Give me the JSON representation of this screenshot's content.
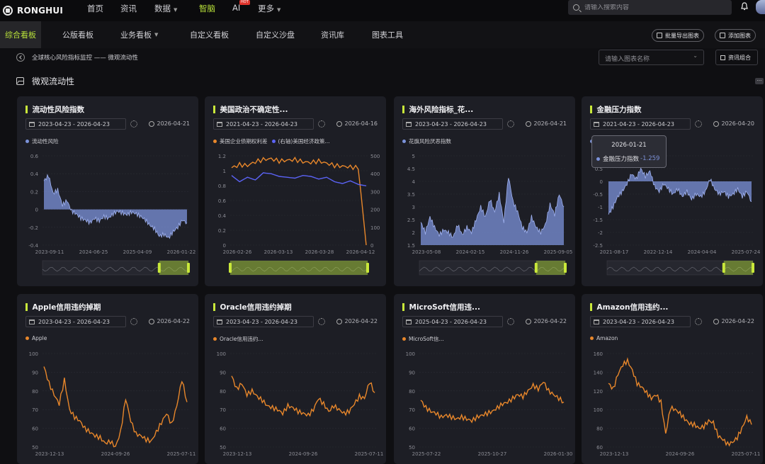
{
  "brand": {
    "name": "RONGHUI"
  },
  "topnav": {
    "items": [
      "首页",
      "资讯",
      "数据",
      "智脑",
      "AI",
      "更多"
    ],
    "ai_badge": "HOT",
    "search_placeholder": "请输入搜索内容"
  },
  "subnav": {
    "tabs": [
      "综合看板",
      "公版看板",
      "业务看板",
      "自定义看板",
      "自定义沙盘",
      "资讯库",
      "图表工具"
    ],
    "export_label": "批量导出图表",
    "add_label": "添加图表",
    "chart_name_placeholder": "请输入图表名称",
    "combo_label": "资讯组合"
  },
  "breadcrumb": "全球核心风险指标监控 —— 微观流动性",
  "section_title": "微观流动性",
  "tooltip": {
    "date": "2026-01-21",
    "series": "金融压力指数",
    "value": "-1.259"
  },
  "colors": {
    "accent": "#c9e83a",
    "blue": "#7c93db",
    "orange": "#e8872b",
    "blue2": "#5b63f5"
  },
  "cards": [
    {
      "title": "流动性风险指数",
      "range": "2023-04-23  -  2026-04-23",
      "updated": "2026-04-21",
      "legend": "流动性风险",
      "legend_color": "#7c93db"
    },
    {
      "title": "美国政治不确定性...",
      "range": "2021-04-23  -  2026-04-23",
      "updated": "2026-04-16",
      "legend": "美国企业债期权利差",
      "legend_color": "#e8872b",
      "legend2": "(右轴)美国经济政策...",
      "legend2_color": "#5b63f5"
    },
    {
      "title": "海外风险指标_花...",
      "range": "2023-04-23  -  2026-04-23",
      "updated": "2026-04-21",
      "legend": "花旗风险厌恶指数",
      "legend_color": "#7c93db"
    },
    {
      "title": "金融压力指数",
      "range": "2021-04-23  -  2026-04-23",
      "updated": "2026-04-20",
      "legend": "金融压力指数",
      "legend_color": "#7c93db"
    },
    {
      "title": "Apple信用违约掉期",
      "range": "2023-04-23  -  2026-04-23",
      "updated": "2026-04-22",
      "legend": "Apple",
      "legend_color": "#e8872b"
    },
    {
      "title": "Oracle信用违约掉期",
      "range": "2023-04-23  -  2026-04-23",
      "updated": "2026-04-22",
      "legend": "Oracle信用违约...",
      "legend_color": "#e8872b"
    },
    {
      "title": "MicroSoft信用违...",
      "range": "2025-04-23  -  2026-04-23",
      "updated": "2026-04-22",
      "legend": "MicroSoft信...",
      "legend_color": "#e8872b"
    },
    {
      "title": "Amazon信用违约...",
      "range": "2023-04-23  -  2026-04-23",
      "updated": "2026-04-22",
      "legend": "Amazon",
      "legend_color": "#e8872b"
    }
  ],
  "chart_data": [
    {
      "type": "area",
      "ylabels": [
        "0.6",
        "0.4",
        "0.2",
        "0",
        "-0.2",
        "-0.4"
      ],
      "xlabels": [
        "2023-09-11",
        "2024-06-25",
        "2025-04-09",
        "2026-01-22"
      ],
      "series": [
        {
          "name": "流动性风险",
          "values": [
            0.32,
            0.38,
            0.18,
            0.22,
            0.05,
            0.1,
            -0.02,
            -0.05,
            -0.1,
            -0.12,
            -0.15,
            -0.1,
            -0.13,
            -0.08,
            -0.1,
            -0.05,
            -0.02,
            -0.04,
            -0.06,
            -0.03,
            -0.05,
            -0.08,
            -0.12,
            -0.18,
            -0.22,
            -0.3,
            -0.28,
            -0.32,
            -0.25,
            -0.2,
            -0.12,
            -0.15
          ]
        }
      ]
    },
    {
      "type": "line",
      "ylabels": [
        "1.2",
        "1",
        "0.8",
        "0.6",
        "0.4",
        "0.2",
        "0"
      ],
      "y2labels": [
        "500",
        "400",
        "300",
        "200",
        "100",
        "0"
      ],
      "xlabels": [
        "2026-02-26",
        "2026-03-13",
        "2026-03-28",
        "2026-04-12"
      ],
      "series": [
        {
          "name": "美国企业债期权利差",
          "values": [
            1.04,
            1.08,
            1.07,
            1.12,
            1.15,
            1.16,
            1.13,
            1.14,
            1.15,
            1.12,
            1.11,
            1.13,
            1.1,
            1.07,
            1.06,
            1.05,
            1.04,
            0.0
          ]
        },
        {
          "name": "(右轴)美国经济政策...",
          "values": [
            390,
            355,
            380,
            365,
            405,
            400,
            385,
            380,
            375,
            390,
            385,
            370,
            380,
            355,
            345,
            360,
            340,
            332
          ]
        }
      ]
    },
    {
      "type": "area",
      "ylabels": [
        "5",
        "4.5",
        "4",
        "3.5",
        "3",
        "2.5",
        "2",
        "1.5"
      ],
      "xlabels": [
        "2023-05-08",
        "2024-02-15",
        "2024-11-26",
        "2025-09-05"
      ],
      "series": [
        {
          "name": "花旗风险厌恶指数",
          "values": [
            2.4,
            2.0,
            2.6,
            2.2,
            1.9,
            2.1,
            2.0,
            1.8,
            2.3,
            1.9,
            2.2,
            2.0,
            2.5,
            3.0,
            2.6,
            3.3,
            2.8,
            3.5,
            2.4,
            4.2,
            3.2,
            2.8,
            2.2,
            2.0,
            2.6,
            2.2,
            2.0,
            2.3,
            3.1,
            2.7,
            3.5,
            3.0
          ]
        }
      ]
    },
    {
      "type": "area",
      "ylabels": [
        "1",
        "0.5",
        "0",
        "-0.5",
        "-1",
        "-1.5",
        "-2",
        "-2.5"
      ],
      "xlabels": [
        "2021-08-17",
        "2022-12-14",
        "2024-04-04",
        "2025-07-24"
      ],
      "series": [
        {
          "name": "金融压力指数",
          "values": [
            -1.3,
            -1.0,
            -0.6,
            -0.4,
            -0.1,
            0.3,
            0.1,
            0.5,
            0.2,
            0.4,
            -0.2,
            -0.4,
            -0.1,
            -0.3,
            -0.5,
            -0.3,
            -0.6,
            -0.4,
            -0.7,
            -0.5,
            -0.6,
            -0.4,
            0.1,
            -0.3,
            -0.5,
            -0.4,
            -0.6,
            -0.5,
            -0.3,
            -0.6,
            -0.4,
            -0.8
          ]
        }
      ]
    },
    {
      "type": "line",
      "ylabels": [
        "100",
        "90",
        "80",
        "70",
        "60",
        "50"
      ],
      "xlabels": [
        "2023-12-13",
        "2024-09-26",
        "2025-07-11"
      ],
      "series": [
        {
          "name": "Apple",
          "values": [
            93,
            84,
            78,
            73,
            86,
            70,
            66,
            64,
            60,
            58,
            56,
            55,
            52,
            53,
            50,
            58,
            76,
            64,
            57,
            56,
            54,
            53,
            58,
            63,
            68,
            62,
            72,
            86,
            74
          ]
        }
      ]
    },
    {
      "type": "line",
      "ylabels": [
        "100",
        "90",
        "80",
        "70",
        "60",
        "50"
      ],
      "xlabels": [
        "2023-12-13",
        "2024-09-26",
        "2025-07-11"
      ],
      "series": [
        {
          "name": "Oracle信用违约...",
          "values": [
            88,
            81,
            84,
            78,
            80,
            77,
            75,
            72,
            71,
            70,
            68,
            72,
            71,
            69,
            68,
            67,
            70,
            76,
            73,
            69,
            72,
            70,
            68,
            69,
            73,
            77,
            76,
            85,
            79
          ]
        }
      ]
    },
    {
      "type": "line",
      "ylabels": [
        "100",
        "90",
        "80",
        "70",
        "60",
        "50"
      ],
      "xlabels": [
        "2025-07-22",
        "2025-10-27",
        "2026-01-30"
      ],
      "series": [
        {
          "name": "MicroSoft信...",
          "values": [
            75,
            71,
            69,
            68,
            66,
            67,
            66,
            65,
            66,
            65,
            64,
            66,
            67,
            68,
            69,
            71,
            73,
            74,
            76,
            78,
            77,
            80,
            83,
            81,
            85,
            80,
            78,
            76,
            74
          ]
        }
      ]
    },
    {
      "type": "line",
      "ylabels": [
        "160",
        "140",
        "120",
        "100",
        "80",
        "60"
      ],
      "xlabels": [
        "2023-12-13",
        "2024-09-26",
        "2025-07-11"
      ],
      "series": [
        {
          "name": "Amazon",
          "values": [
            128,
            122,
            138,
            148,
            152,
            142,
            128,
            124,
            118,
            112,
            116,
            108,
            74,
            102,
            100,
            96,
            90,
            85,
            84,
            80,
            82,
            88,
            86,
            72,
            68,
            63,
            65,
            70,
            80,
            92,
            84
          ]
        }
      ]
    }
  ]
}
